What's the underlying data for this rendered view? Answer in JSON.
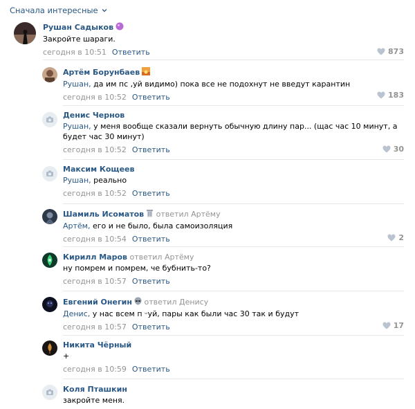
{
  "sort_label": "Сначала интересные",
  "comments": [
    {
      "author": "Рушан Садыков",
      "reply_to": "",
      "mention": "",
      "text": "Закройте шараги.",
      "time": "сегодня в 10:51",
      "reply": "Ответить",
      "likes": "873",
      "emoji": "purple-bubble"
    },
    {
      "author": "Артём Борунбаев",
      "reply_to": "",
      "mention": "Рушан,",
      "text": " да им пс  ,уй видимо) пока все не подохнут не введут карантин",
      "time": "сегодня в 10:52",
      "reply": "Ответить",
      "likes": "183",
      "emoji": "sunrise"
    },
    {
      "author": "Денис Чернов",
      "reply_to": "",
      "mention": "Рушан,",
      "text": " у меня вообще сказали вернуть обычную длину пар... (щас час 10 минут, а будет час 30 минут)",
      "time": "сегодня в 10:52",
      "reply": "Ответить",
      "likes": "30",
      "emoji": ""
    },
    {
      "author": "Максим Кощеев",
      "reply_to": "",
      "mention": "Рушан,",
      "text": " реально",
      "time": "сегодня в 10:52",
      "reply": "Ответить",
      "likes": "",
      "emoji": ""
    },
    {
      "author": "Шамиль Исоматов",
      "reply_to": "ответил Артёму",
      "mention": "Артём,",
      "text": " его и не было, была самоизоляция",
      "time": "сегодня в 10:54",
      "reply": "Ответить",
      "likes": "2",
      "emoji": "trash"
    },
    {
      "author": "Кирилл Маров",
      "reply_to": "ответил Артёму",
      "mention": "",
      "text": "ну помрем и помрем, че бубнить-то?",
      "time": "сегодня в 10:57",
      "reply": "Ответить",
      "likes": "",
      "emoji": ""
    },
    {
      "author": "Евгений Онегин",
      "reply_to": "ответил Денису",
      "mention": "Денис,",
      "text": " у нас всем п  ᵕуй, пары как были час 30 так и будут",
      "time": "сегодня в 10:57",
      "reply": "Ответить",
      "likes": "17",
      "emoji": "alien"
    },
    {
      "author": "Никита Чёрный",
      "reply_to": "",
      "mention": "",
      "text": "+",
      "time": "сегодня в 10:59",
      "reply": "Ответить",
      "likes": "",
      "emoji": ""
    },
    {
      "author": "Коля Пташкин",
      "reply_to": "",
      "mention": "",
      "text": "закройте меня.",
      "time": "",
      "reply": "",
      "likes": "",
      "emoji": ""
    }
  ],
  "colors": {
    "link": "#2a5885",
    "muted": "#939393",
    "separator": "#e7e8ec"
  }
}
